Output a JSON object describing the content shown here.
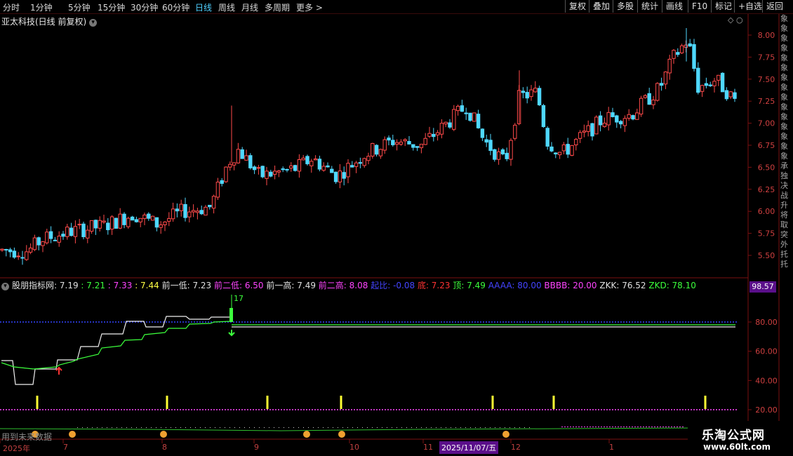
{
  "toolbar": {
    "periods": [
      "分时",
      "1分钟",
      "5分钟",
      "15分钟",
      "30分钟",
      "60分钟",
      "日线",
      "周线",
      "月线",
      "多周期",
      "更多 >"
    ],
    "active_period": "日线",
    "right_buttons": [
      "复权",
      "叠加",
      "多股",
      "统计",
      "画线",
      "F10",
      "标记",
      "+自选",
      "返回"
    ]
  },
  "stock": {
    "title": "亚太科技(日线 前复权)"
  },
  "indicator": {
    "name": "股朋指标网",
    "values": [
      {
        "text": ": 7.19",
        "color": "#e0e0e0"
      },
      {
        "text": " : 7.21",
        "color": "#3cff3c"
      },
      {
        "text": " : 7.33",
        "color": "#ff44ff"
      },
      {
        "text": " : 7.44",
        "color": "#ffff44"
      },
      {
        "text": " 前一低: 7.23",
        "color": "#e0e0e0"
      },
      {
        "text": " 前二低: 6.50",
        "color": "#ff44ff"
      },
      {
        "text": " 前一高: 7.49",
        "color": "#e0e0e0"
      },
      {
        "text": " 前二高: 8.08",
        "color": "#ff44ff"
      },
      {
        "text": " 起比: -0.08",
        "color": "#4444ff"
      },
      {
        "text": " 底: 7.23",
        "color": "#ff3333"
      },
      {
        "text": " 顶: 7.49",
        "color": "#3cff3c"
      },
      {
        "text": " AAAA: 80.00",
        "color": "#4444ff"
      },
      {
        "text": " BBBB: 20.00",
        "color": "#ff44ff"
      },
      {
        "text": " ZKK: 76.52",
        "color": "#e0e0e0"
      },
      {
        "text": " ZKD: 78.10",
        "color": "#3cff3c"
      }
    ],
    "badge": "98.57",
    "signal_label": "17"
  },
  "yaxis_price": [
    "8.00",
    "7.75",
    "7.50",
    "7.25",
    "7.00",
    "6.75",
    "6.50",
    "6.25",
    "6.00",
    "5.75",
    "5.50"
  ],
  "yaxis_ind": [
    "80.00",
    "60.00",
    "40.00",
    "20.00"
  ],
  "xaxis": {
    "labels": [
      "2025年",
      "7",
      "8",
      "9",
      "10",
      "11",
      "12",
      "1"
    ],
    "highlight": "2025/11/07/五"
  },
  "future_text": "用到未来数据",
  "side_text": "象象象象象象象象象象象象象象象承独决战升将取突外托托",
  "watermark": {
    "name": "乐淘公式网",
    "url": "www.60lt.com"
  },
  "colors": {
    "up": "#ff4a4a",
    "down": "#4fd8ff",
    "grid": "#7a1010"
  }
}
